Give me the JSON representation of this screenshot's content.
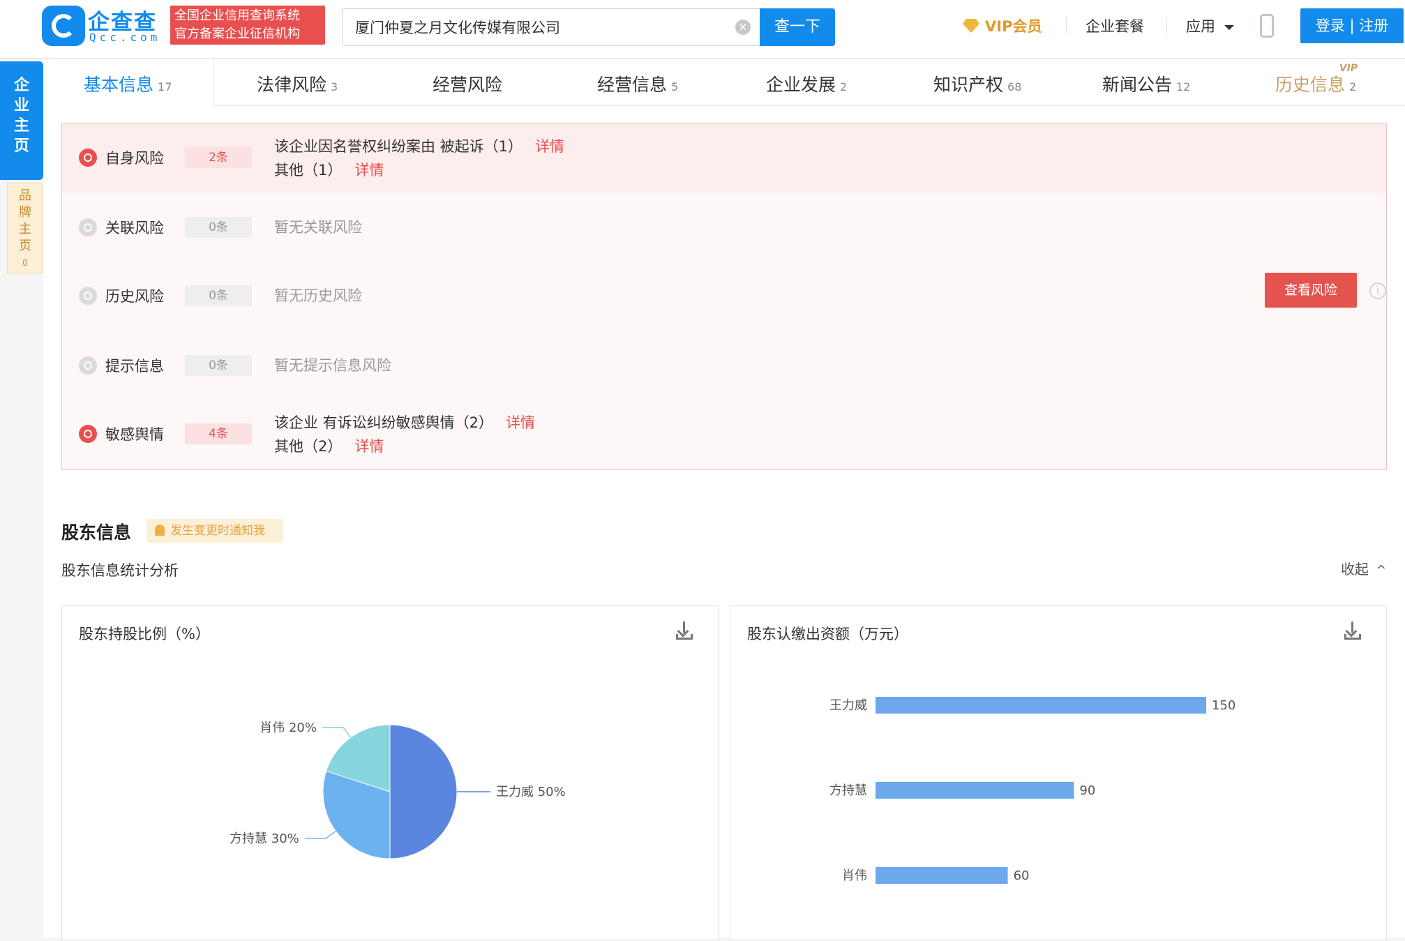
{
  "header": {
    "logo_text": "企查查",
    "logo_sub": "Qcc.com",
    "badge_line1": "全国企业信用查询系统",
    "badge_line2": "官方备案企业征信机构",
    "search_value": "厦门仲夏之月文化传媒有限公司",
    "search_button": "查一下",
    "vip_label": "VIP会员",
    "package_label": "企业套餐",
    "apps_label": "应用",
    "login_label": "登录 | 注册"
  },
  "side": {
    "main_label": "企业主页",
    "brand_label": "品牌主页",
    "brand_count": "0"
  },
  "tabs": [
    {
      "label": "基本信息",
      "count": "17"
    },
    {
      "label": "法律风险",
      "count": "3"
    },
    {
      "label": "经营风险",
      "count": ""
    },
    {
      "label": "经营信息",
      "count": "5"
    },
    {
      "label": "企业发展",
      "count": "2"
    },
    {
      "label": "知识产权",
      "count": "68"
    },
    {
      "label": "新闻公告",
      "count": "12"
    },
    {
      "label": "历史信息",
      "count": "2",
      "badge": "VIP"
    }
  ],
  "risk": {
    "rows": [
      {
        "name": "自身风险",
        "count": "2条",
        "lines": [
          {
            "text": "该企业因名誉权纠纷案由 被起诉（1）",
            "link": "详情"
          },
          {
            "text": "其他（1）",
            "link": "详情"
          }
        ]
      },
      {
        "name": "关联风险",
        "count": "0条",
        "empty": "暂无关联风险"
      },
      {
        "name": "历史风险",
        "count": "0条",
        "empty": "暂无历史风险"
      },
      {
        "name": "提示信息",
        "count": "0条",
        "empty": "暂无提示信息风险"
      },
      {
        "name": "敏感舆情",
        "count": "4条",
        "lines": [
          {
            "text": "该企业 有诉讼纠纷敏感舆情（2）",
            "link": "详情"
          },
          {
            "text": "其他（2）",
            "link": "详情"
          }
        ]
      }
    ],
    "view_button": "查看风险",
    "info_glyph": "i"
  },
  "shareholders": {
    "title": "股东信息",
    "notify": "发生变更时通知我",
    "subtitle": "股东信息统计分析",
    "collapse": "收起",
    "collapse_glyph": "^"
  },
  "chart_data": [
    {
      "type": "pie",
      "title": "股东持股比例（%）",
      "labels": [
        "王力威",
        "方持慧",
        "肖伟"
      ],
      "values": [
        50,
        30,
        20
      ],
      "colors": [
        "#5b86e0",
        "#6cb2ee",
        "#86d4dc"
      ]
    },
    {
      "type": "bar",
      "orientation": "horizontal",
      "title": "股东认缴出资额（万元）",
      "categories": [
        "王力威",
        "方持慧",
        "肖伟"
      ],
      "values": [
        150,
        90,
        60
      ],
      "color": "#6ea8ec"
    }
  ]
}
